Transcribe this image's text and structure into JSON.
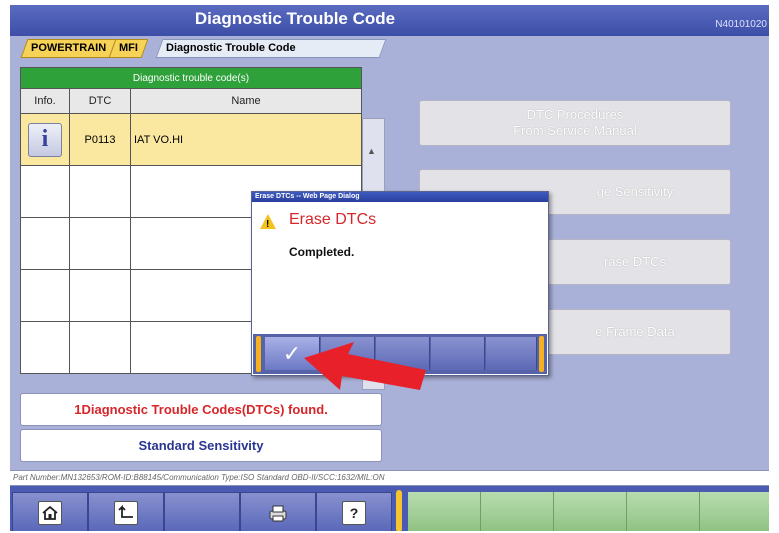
{
  "window": {
    "title": "Diagnostic Trouble Code",
    "screen_code": "N40101020"
  },
  "breadcrumb": [
    "POWERTRAIN",
    "MFI",
    "Diagnostic Trouble Code"
  ],
  "dtc_table": {
    "caption": "Diagnostic trouble code(s)",
    "headers": {
      "info": "Info.",
      "dtc": "DTC",
      "name": "Name"
    },
    "rows": [
      {
        "dtc": "P0113",
        "name": "IAT VO.HI"
      }
    ]
  },
  "right_buttons": {
    "dtc_procedures_line1": "DTC Procedures",
    "dtc_procedures_line2": "From Service Manual",
    "change_sensitivity": "ge Sensitivity",
    "erase_dtcs": "rase DTCs",
    "freeze_frame": "e Frame Data"
  },
  "status": {
    "found": "1Diagnostic Trouble Codes(DTCs) found.",
    "sensitivity": "Standard Sensitivity"
  },
  "part_number_line": "Part Number:MN132653/ROM-ID:B88145/Communication Type:ISO Standard OBD-II/SCC:1632/MIL:ON",
  "dialog": {
    "title": "Erase DTCs -- Web Page Dialog",
    "heading": "Erase DTCs",
    "message": "Completed.",
    "ok_icon": "checkmark-icon"
  },
  "toolbar": {
    "help_label": "?"
  },
  "colors": {
    "title_bar": "#3d4ea8",
    "background": "#a9b1d8",
    "table_caption": "#2fa13a",
    "selected_row": "#fbe8a0",
    "found_text": "#d6262a",
    "sensitivity_text": "#2a3592",
    "accent_yellow": "#f6c430",
    "arrow": "#e8202a"
  }
}
